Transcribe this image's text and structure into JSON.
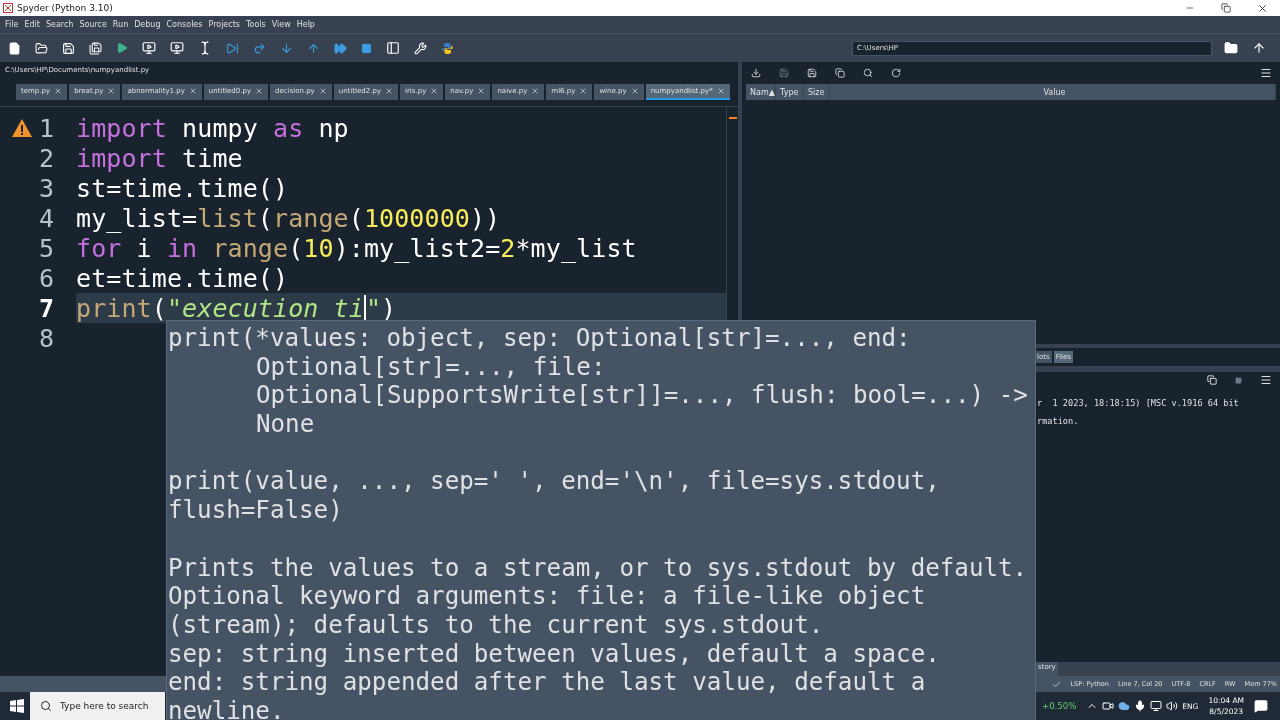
{
  "window": {
    "title": "Spyder (Python 3.10)"
  },
  "menu": [
    "File",
    "Edit",
    "Search",
    "Source",
    "Run",
    "Debug",
    "Consoles",
    "Projects",
    "Tools",
    "View",
    "Help"
  ],
  "working_directory": {
    "value": "C:\\Users\\HP"
  },
  "editor": {
    "path": "C:\\Users\\HP\\Documents\\numpyandlist.py",
    "tabs": [
      {
        "label": "temp.py",
        "selected": false
      },
      {
        "label": "breat.py",
        "selected": false
      },
      {
        "label": "abnormality1.py",
        "selected": false
      },
      {
        "label": "untitled0.py",
        "selected": false
      },
      {
        "label": "decision.py",
        "selected": false
      },
      {
        "label": "untitled2.py",
        "selected": false
      },
      {
        "label": "iris.py",
        "selected": false
      },
      {
        "label": "nav.py",
        "selected": false
      },
      {
        "label": "naive.py",
        "selected": false
      },
      {
        "label": "ml6.py",
        "selected": false
      },
      {
        "label": "wine.py",
        "selected": false
      },
      {
        "label": "numpyandlist.py*",
        "selected": true
      }
    ],
    "lines": [
      {
        "number": "1",
        "current": false,
        "warning": true,
        "tokens": [
          {
            "kind": "kw",
            "text": "import"
          },
          {
            "kind": "plain",
            "text": " numpy "
          },
          {
            "kind": "kw",
            "text": "as"
          },
          {
            "kind": "plain",
            "text": " np"
          }
        ]
      },
      {
        "number": "2",
        "current": false,
        "warning": false,
        "tokens": [
          {
            "kind": "kw",
            "text": "import"
          },
          {
            "kind": "plain",
            "text": " time"
          }
        ]
      },
      {
        "number": "3",
        "current": false,
        "warning": false,
        "tokens": [
          {
            "kind": "plain",
            "text": "st=time.time()"
          }
        ]
      },
      {
        "number": "4",
        "current": false,
        "warning": false,
        "tokens": [
          {
            "kind": "plain",
            "text": "my_list="
          },
          {
            "kind": "builtin",
            "text": "list"
          },
          {
            "kind": "plain",
            "text": "("
          },
          {
            "kind": "builtin",
            "text": "range"
          },
          {
            "kind": "plain",
            "text": "("
          },
          {
            "kind": "num",
            "text": "1000000"
          },
          {
            "kind": "plain",
            "text": "))"
          }
        ]
      },
      {
        "number": "5",
        "current": false,
        "warning": false,
        "tokens": [
          {
            "kind": "kw",
            "text": "for"
          },
          {
            "kind": "plain",
            "text": " i "
          },
          {
            "kind": "kw",
            "text": "in"
          },
          {
            "kind": "builtin",
            "text": " range"
          },
          {
            "kind": "plain",
            "text": "("
          },
          {
            "kind": "num",
            "text": "10"
          },
          {
            "kind": "plain",
            "text": "):my_list2="
          },
          {
            "kind": "num",
            "text": "2"
          },
          {
            "kind": "plain",
            "text": "*my_list"
          }
        ]
      },
      {
        "number": "6",
        "current": false,
        "warning": false,
        "tokens": [
          {
            "kind": "plain",
            "text": "et=time.time()"
          }
        ]
      },
      {
        "number": "7",
        "current": true,
        "warning": false,
        "tokens": [
          {
            "kind": "builtin",
            "text": "print"
          },
          {
            "kind": "plain",
            "text": "("
          },
          {
            "kind": "str",
            "text": "\"execution ti"
          },
          {
            "kind": "caret"
          },
          {
            "kind": "str",
            "text": "\""
          },
          {
            "kind": "plain",
            "text": ")"
          }
        ]
      },
      {
        "number": "8",
        "current": false,
        "warning": false
      }
    ]
  },
  "calltip": {
    "blocks": [
      [
        {
          "text": "print(*values: object, sep: Optional[str]=..., end:",
          "indented": false
        },
        {
          "text": "Optional[str]=..., file:",
          "indented": true
        },
        {
          "text": "Optional[SupportsWrite[str]]=..., flush: bool=...) ->",
          "indented": true
        },
        {
          "text": "None",
          "indented": true
        }
      ],
      [
        {
          "text": "print(value, ..., sep=' ', end='\\n', file=sys.stdout,",
          "indented": false
        },
        {
          "text": "flush=False)",
          "indented": false
        }
      ],
      [
        {
          "text": "Prints the values to a stream, or to sys.stdout by default.",
          "indented": false
        },
        {
          "text": "Optional keyword arguments: file: a file-like object",
          "indented": false
        },
        {
          "text": "(stream); defaults to the current sys.stdout.",
          "indented": false
        },
        {
          "text": "sep: string inserted between values, default a space.",
          "indented": false
        },
        {
          "text": "end: string appended after the last value, default a",
          "indented": false
        },
        {
          "text": "newline.",
          "indented": false
        }
      ]
    ]
  },
  "variable_explorer": {
    "columns": [
      "Nam▲",
      "Type",
      "Size",
      "Value"
    ]
  },
  "pane_tabs": [
    {
      "label": "lots",
      "selected": false
    },
    {
      "label": "Files",
      "selected": true
    }
  ],
  "console": {
    "lines": [
      "r  1 2023, 18:18:15) [MSC v.1916 64 bit",
      "rmation."
    ]
  },
  "bottom_tab": "story",
  "status_bar": [
    "LSP: Python",
    "Line 7, Col 20",
    "UTF-8",
    "CRLF",
    "RW",
    "Mem 77%"
  ],
  "taskbar": {
    "search_placeholder": "Type here to search",
    "stock": "+0.50%",
    "language": "ENG",
    "time": "10:04 AM",
    "date": "8/5/2023"
  }
}
